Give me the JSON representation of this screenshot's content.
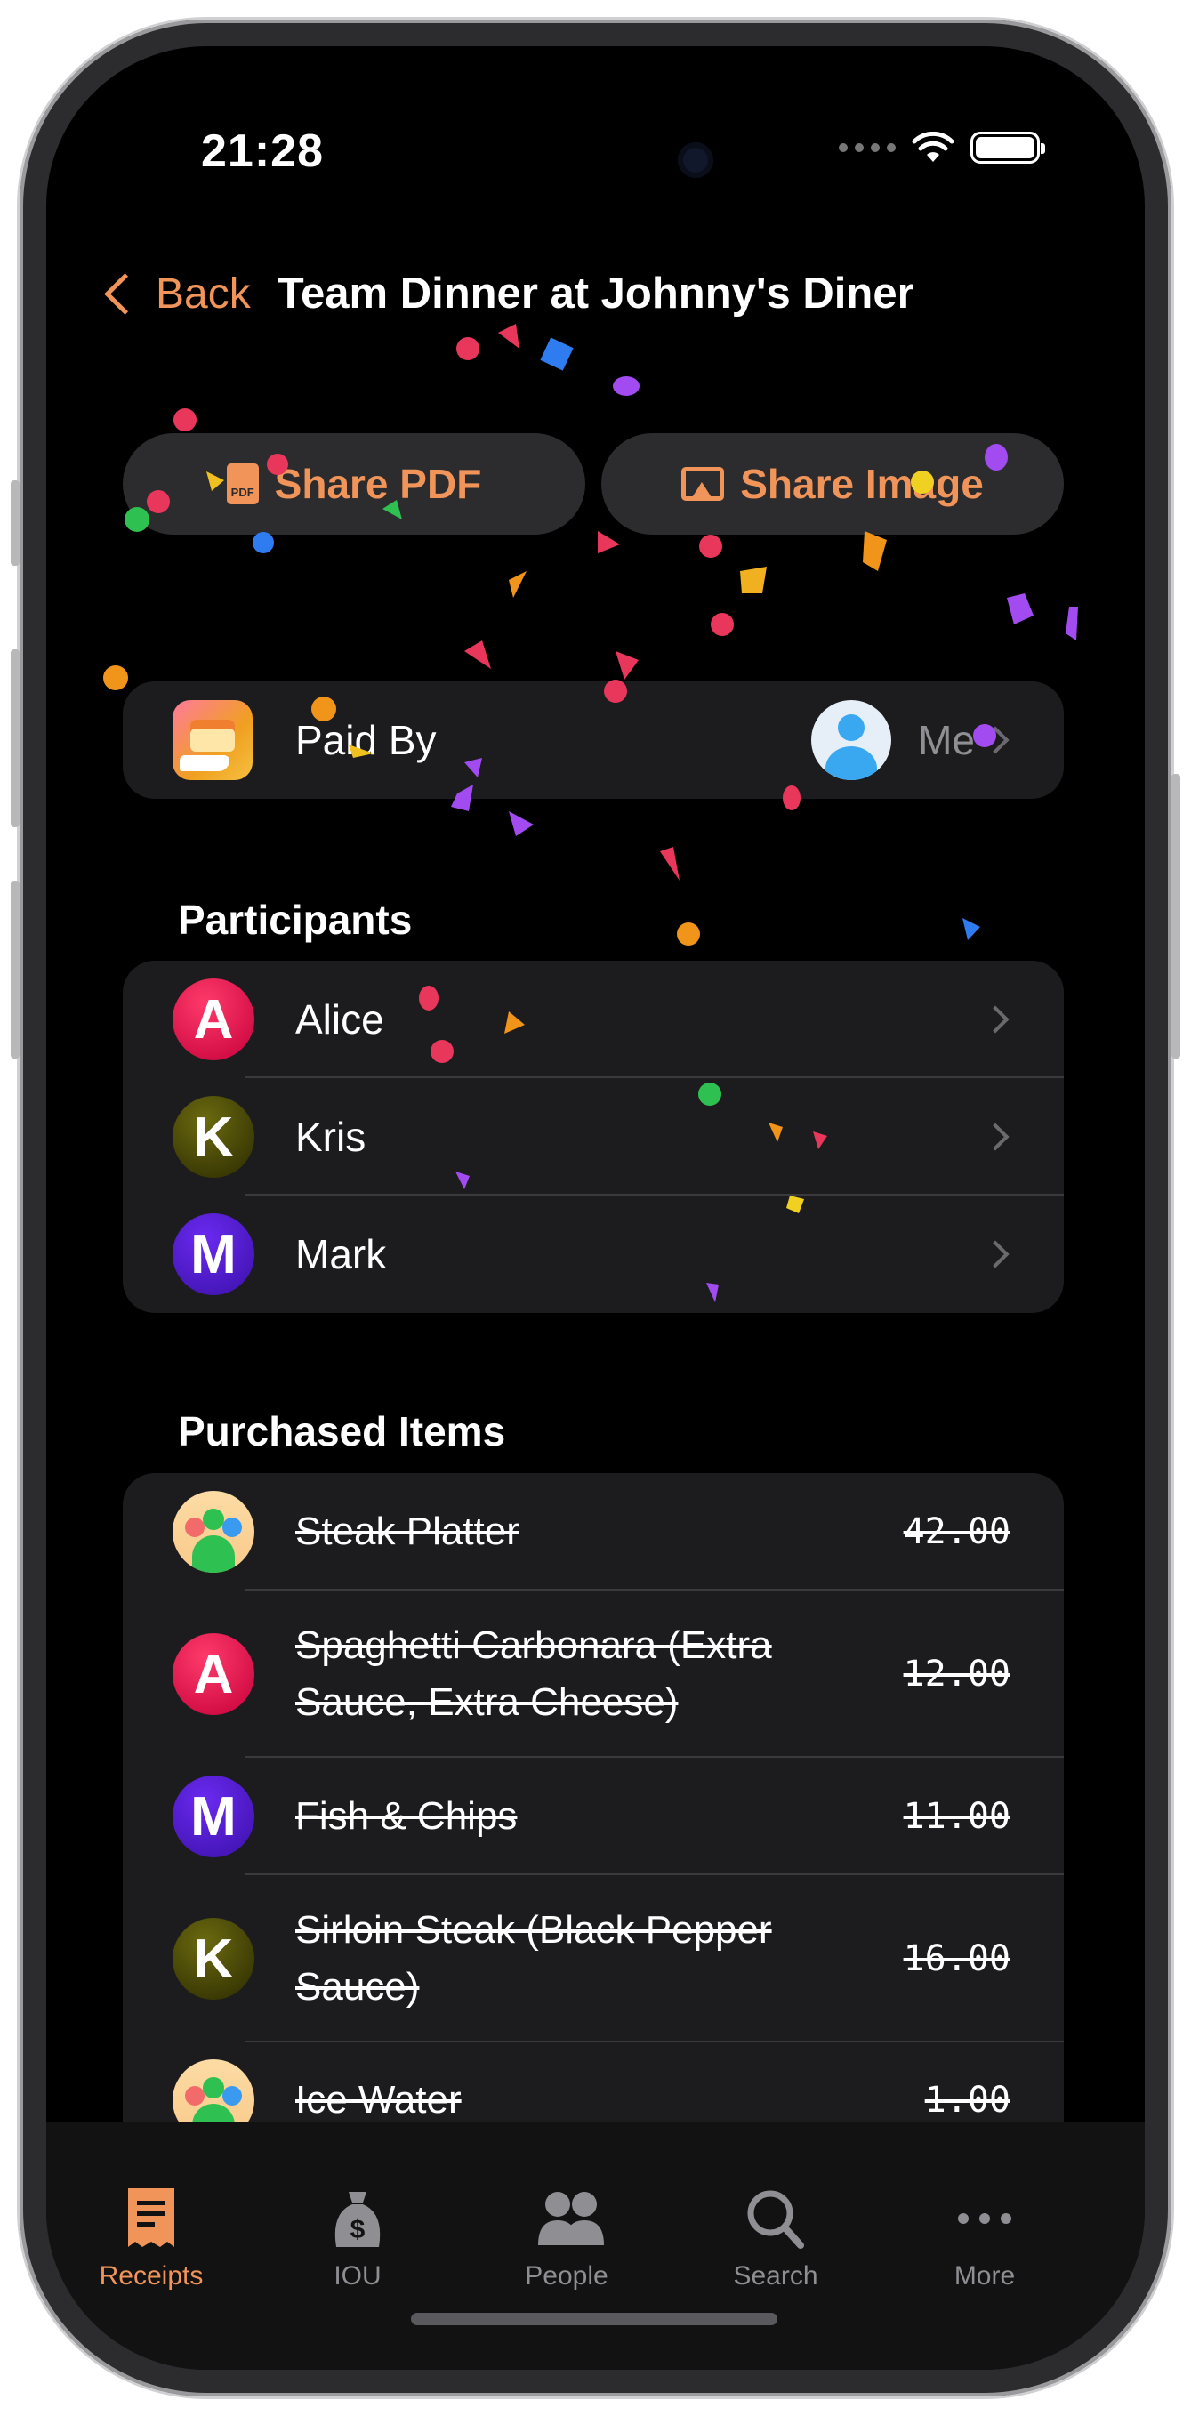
{
  "status": {
    "time": "21:28"
  },
  "nav": {
    "back_label": "Back",
    "title": "Team Dinner at Johnny's Diner"
  },
  "actions": {
    "share_pdf": "Share PDF",
    "share_image": "Share Image"
  },
  "paid_by": {
    "label": "Paid By",
    "payer": "Me"
  },
  "participants": {
    "heading": "Participants",
    "people": [
      {
        "initial": "A",
        "name": "Alice"
      },
      {
        "initial": "K",
        "name": "Kris"
      },
      {
        "initial": "M",
        "name": "Mark"
      }
    ]
  },
  "purchased": {
    "heading": "Purchased Items",
    "items": [
      {
        "avatar": "group",
        "name": "Steak Platter",
        "price": "42.00"
      },
      {
        "avatar": "A",
        "name": "Spaghetti Carbonara (Extra Sauce, Extra Cheese)",
        "price": "12.00"
      },
      {
        "avatar": "M",
        "name": "Fish & Chips",
        "price": "11.00"
      },
      {
        "avatar": "K",
        "name": "Sirloin Steak (Black Pepper Sauce)",
        "price": "16.00"
      },
      {
        "avatar": "group",
        "name": "Ice Water",
        "price": "1.00"
      }
    ]
  },
  "tabs": [
    {
      "label": "Receipts",
      "icon": "receipt-icon",
      "active": true
    },
    {
      "label": "IOU",
      "icon": "money-bag-icon",
      "active": false
    },
    {
      "label": "People",
      "icon": "people-icon",
      "active": false
    },
    {
      "label": "Search",
      "icon": "search-icon",
      "active": false
    },
    {
      "label": "More",
      "icon": "ellipsis-icon",
      "active": false
    }
  ],
  "colors": {
    "accent": "#f0945a",
    "card": "#1c1c1e",
    "background": "#000000"
  }
}
